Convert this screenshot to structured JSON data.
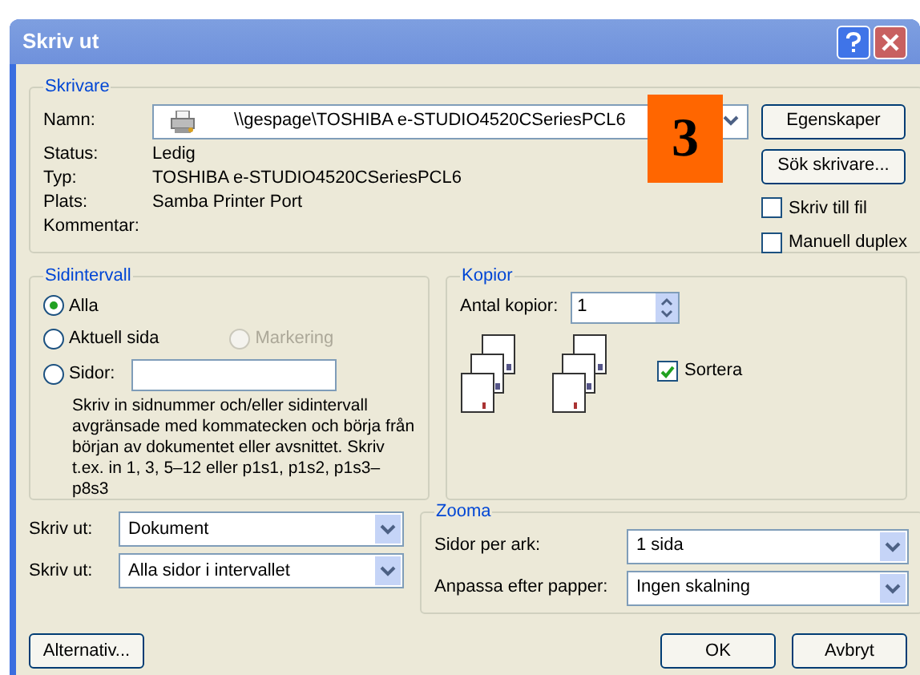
{
  "window": {
    "title": "Skriv ut"
  },
  "printer": {
    "legend": "Skrivare",
    "name_label": "Namn:",
    "name_value": "\\\\gespage\\TOSHIBA e-STUDIO4520CSeriesPCL6",
    "info": [
      {
        "label": "Status:",
        "value": "Ledig"
      },
      {
        "label": "Typ:",
        "value": "TOSHIBA e-STUDIO4520CSeriesPCL6"
      },
      {
        "label": "Plats:",
        "value": "Samba Printer Port"
      },
      {
        "label": "Kommentar:"
      }
    ],
    "buttons": [
      "Egenskaper",
      "Sök skrivare..."
    ],
    "checkboxes": [
      {
        "label": "Skriv till fil",
        "checked": false
      },
      {
        "label": "Manuell duplex",
        "checked": false
      }
    ]
  },
  "badge": "3",
  "page_range": {
    "legend": "Sidintervall",
    "options": [
      {
        "label": "Alla",
        "selected": true,
        "disabled": false
      },
      {
        "label": "Aktuell sida",
        "selected": false,
        "disabled": false
      },
      {
        "label": "Markering",
        "selected": false,
        "disabled": true
      },
      {
        "label": "Sidor:",
        "selected": false,
        "disabled": false
      }
    ],
    "hint": "Skriv in sidnummer och/eller sidintervall avgränsade med kommatecken och börja från början av dokumentet eller avsnittet. Skriv t.ex. in 1, 3, 5–12 eller p1s1, p1s2, p1s3–p8s3"
  },
  "copies": {
    "legend": "Kopior",
    "label": "Antal kopior:",
    "value": "1",
    "collate": {
      "label": "Sortera",
      "checked": true
    }
  },
  "print_what": [
    {
      "label": "Skriv ut:",
      "value": "Dokument"
    },
    {
      "label": "Skriv ut:",
      "value": "Alla sidor i intervallet"
    }
  ],
  "zoom": {
    "legend": "Zooma",
    "rows": [
      {
        "label": "Sidor per ark:",
        "value": "1 sida"
      },
      {
        "label": "Anpassa efter papper:",
        "value": "Ingen skalning"
      }
    ]
  },
  "footer_buttons": [
    "Alternativ...",
    "OK",
    "Avbryt"
  ]
}
